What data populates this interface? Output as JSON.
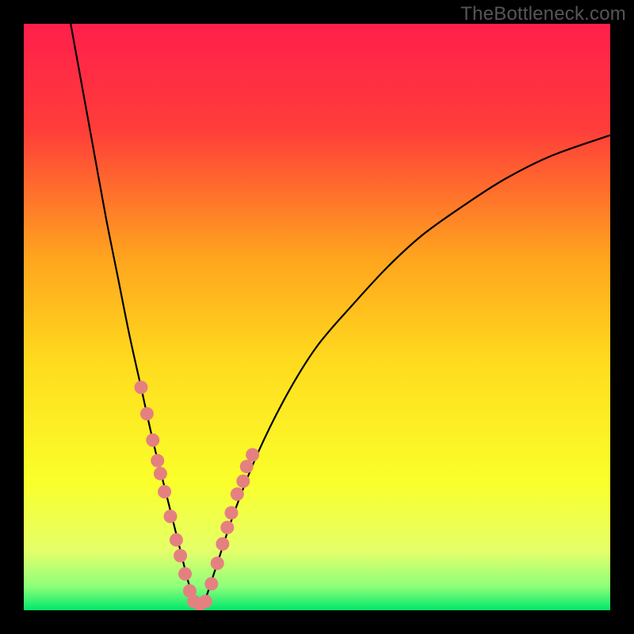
{
  "watermark": "TheBottleneck.com",
  "chart_data": {
    "type": "line",
    "title": "",
    "xlabel": "",
    "ylabel": "",
    "xlim": [
      0,
      100
    ],
    "ylim": [
      0,
      100
    ],
    "gradient_stops": [
      {
        "offset": 0.0,
        "color": "#ff1f4b"
      },
      {
        "offset": 0.18,
        "color": "#ff3d3a"
      },
      {
        "offset": 0.4,
        "color": "#ffa51e"
      },
      {
        "offset": 0.58,
        "color": "#ffdc1e"
      },
      {
        "offset": 0.78,
        "color": "#faff2a"
      },
      {
        "offset": 0.9,
        "color": "#e4ff6a"
      },
      {
        "offset": 0.96,
        "color": "#8cff7a"
      },
      {
        "offset": 1.0,
        "color": "#00e86a"
      }
    ],
    "series": [
      {
        "name": "bottleneck-curve",
        "stroke": "#000000",
        "x": [
          8,
          10,
          12,
          14,
          16,
          18,
          20,
          22,
          24,
          26,
          27,
          28,
          29,
          30,
          31,
          33,
          36,
          40,
          45,
          50,
          56,
          62,
          68,
          75,
          82,
          90,
          100
        ],
        "y": [
          100,
          89,
          78,
          67,
          57,
          47,
          38,
          29,
          21,
          13,
          9,
          5,
          2,
          0.5,
          2,
          8,
          17,
          27,
          37,
          45,
          52,
          58.5,
          64,
          69,
          73.5,
          77.5,
          81
        ]
      }
    ],
    "marker_color": "#e58081",
    "marker_radius_px": 8.5,
    "markers": {
      "left_branch": [
        {
          "x": 20.0,
          "y": 38.0
        },
        {
          "x": 21.0,
          "y": 33.5
        },
        {
          "x": 22.0,
          "y": 29.0
        },
        {
          "x": 22.8,
          "y": 25.5
        },
        {
          "x": 23.3,
          "y": 23.3
        },
        {
          "x": 24.0,
          "y": 20.2
        },
        {
          "x": 25.0,
          "y": 16.0
        },
        {
          "x": 26.0,
          "y": 12.0
        },
        {
          "x": 26.7,
          "y": 9.3
        },
        {
          "x": 27.5,
          "y": 6.2
        },
        {
          "x": 28.3,
          "y": 3.3
        }
      ],
      "bottom": [
        {
          "x": 29.0,
          "y": 1.5
        },
        {
          "x": 30.0,
          "y": 1.0
        },
        {
          "x": 31.0,
          "y": 1.5
        }
      ],
      "right_branch": [
        {
          "x": 32.0,
          "y": 4.5
        },
        {
          "x": 33.0,
          "y": 8.0
        },
        {
          "x": 33.9,
          "y": 11.3
        },
        {
          "x": 34.7,
          "y": 14.1
        },
        {
          "x": 35.4,
          "y": 16.6
        },
        {
          "x": 36.4,
          "y": 19.8
        },
        {
          "x": 37.4,
          "y": 22.0
        },
        {
          "x": 38.0,
          "y": 24.5
        },
        {
          "x": 39.0,
          "y": 26.5
        }
      ]
    }
  }
}
